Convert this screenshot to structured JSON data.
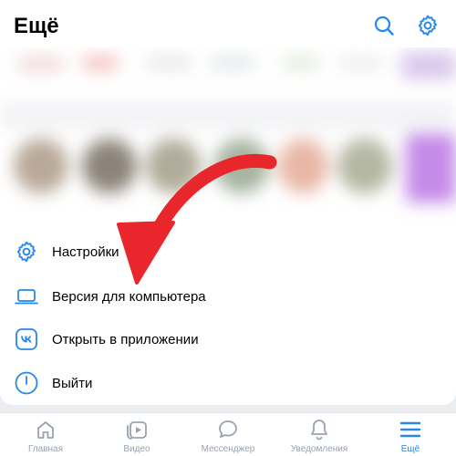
{
  "header": {
    "title": "Ещё",
    "search_icon": "search-icon",
    "settings_icon": "gear-icon"
  },
  "menu": [
    {
      "label": "Настройки",
      "icon": "gear-icon"
    },
    {
      "label": "Версия для компьютера",
      "icon": "laptop-icon"
    },
    {
      "label": "Открыть в приложении",
      "icon": "vk-logo-icon"
    },
    {
      "label": "Выйти",
      "icon": "power-icon"
    }
  ],
  "tabs": [
    {
      "label": "Главная",
      "icon": "home-icon",
      "active": false
    },
    {
      "label": "Видео",
      "icon": "video-icon",
      "active": false
    },
    {
      "label": "Мессенджер",
      "icon": "chat-icon",
      "active": false
    },
    {
      "label": "Уведомления",
      "icon": "bell-icon",
      "active": false
    },
    {
      "label": "Ещё",
      "icon": "menu-icon",
      "active": true
    }
  ],
  "colors": {
    "accent": "#2688eb",
    "inactive": "#99a2ad",
    "arrow": "#e8262c",
    "background": "#ebedf0"
  }
}
